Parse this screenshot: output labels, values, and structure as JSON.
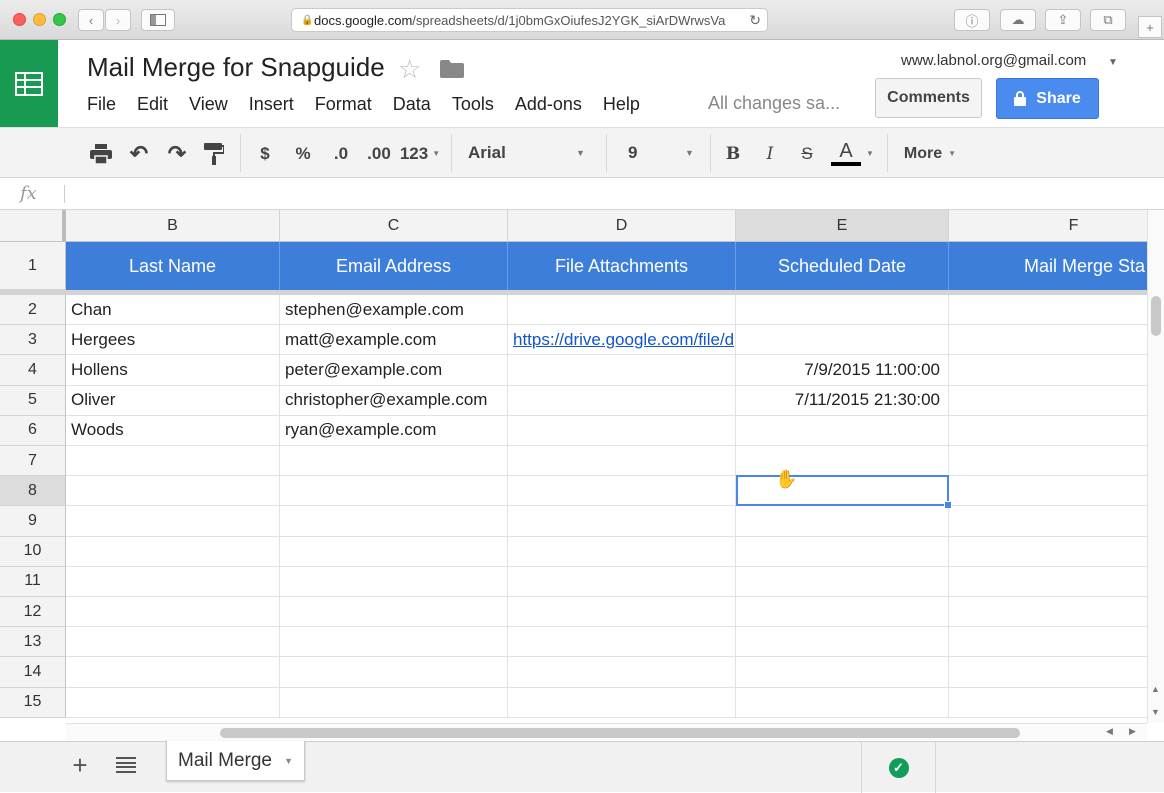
{
  "browser": {
    "url_host": "docs.google.com",
    "url_path": "/spreadsheets/d/1j0bmGxOiufesJ2YGK_siArDWrwsVa"
  },
  "doc": {
    "title": "Mail Merge for Snapguide",
    "account": "www.labnol.org@gmail.com",
    "save_status": "All changes sa...",
    "comments_label": "Comments",
    "share_label": "Share",
    "accent_color": "#189a52",
    "share_color": "#4a8bf0"
  },
  "menu": [
    "File",
    "Edit",
    "View",
    "Insert",
    "Format",
    "Data",
    "Tools",
    "Add-ons",
    "Help"
  ],
  "toolbar": {
    "currency": "$",
    "percent": "%",
    "dec_decrease": ".0",
    "dec_increase": ".00",
    "number_format": "123",
    "font": "Arial",
    "font_size": "9",
    "bold": "B",
    "italic": "I",
    "strike": "S",
    "text_color": "A",
    "more": "More"
  },
  "formula_bar": {
    "icon": "fx"
  },
  "grid": {
    "columns": [
      "B",
      "C",
      "D",
      "E",
      "F"
    ],
    "active_column": "E",
    "rows": [
      "1",
      "2",
      "3",
      "4",
      "5",
      "6",
      "7",
      "8",
      "9",
      "10",
      "11",
      "12",
      "13",
      "14",
      "15"
    ],
    "active_row": "8",
    "header_row": [
      "Last Name",
      "Email Address",
      "File Attachments",
      "Scheduled Date",
      "Mail Merge Sta"
    ],
    "header_color": "#3d7edb",
    "data": [
      [
        "Chan",
        "stephen@example.com",
        "",
        "",
        ""
      ],
      [
        "Hergees",
        "matt@example.com",
        "https://drive.google.com/file/d",
        "",
        ""
      ],
      [
        "Hollens",
        "peter@example.com",
        "",
        "7/9/2015 11:00:00",
        ""
      ],
      [
        "Oliver",
        "christopher@example.com",
        "",
        "7/11/2015 21:30:00",
        ""
      ],
      [
        "Woods",
        "ryan@example.com",
        "",
        "",
        ""
      ]
    ]
  },
  "sheet": {
    "tab_name": "Mail Merge"
  }
}
